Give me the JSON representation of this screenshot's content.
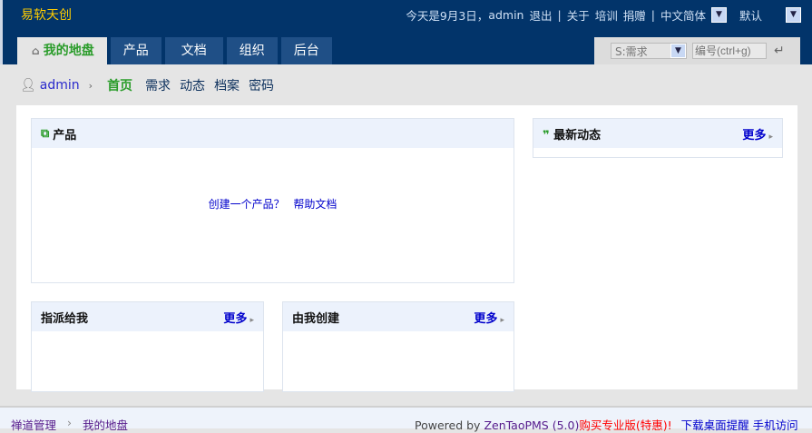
{
  "brand": "易软天创",
  "top": {
    "greeting": "今天是9月3日，",
    "user": "admin",
    "logout": "退出",
    "sep": "|",
    "about": "关于",
    "training": "培训",
    "donate": "捐赠",
    "language": "中文简体",
    "theme": "默认"
  },
  "tabs": [
    "我的地盘",
    "产品",
    "文档",
    "组织",
    "后台"
  ],
  "search": {
    "type": "S:需求",
    "placeholder": "编号(ctrl+g)"
  },
  "subnav": {
    "user": "admin",
    "items": [
      "首页",
      "需求",
      "动态",
      "档案",
      "密码"
    ]
  },
  "blocks": {
    "product": {
      "title": "产品",
      "create": "创建一个产品？",
      "help": "帮助文档"
    },
    "dynamic": {
      "title": "最新动态",
      "more": "更多"
    },
    "assigned": {
      "title": "指派给我",
      "more": "更多"
    },
    "created": {
      "title": "由我创建",
      "more": "更多"
    }
  },
  "footer": {
    "crumb1": "禅道管理",
    "crumb2": "我的地盘",
    "powered": "Powered by",
    "product": "ZenTaoPMS (5.0)",
    "buy": "购买专业版(特惠)!",
    "download": "下载桌面提醒",
    "mobile": "手机访问"
  }
}
